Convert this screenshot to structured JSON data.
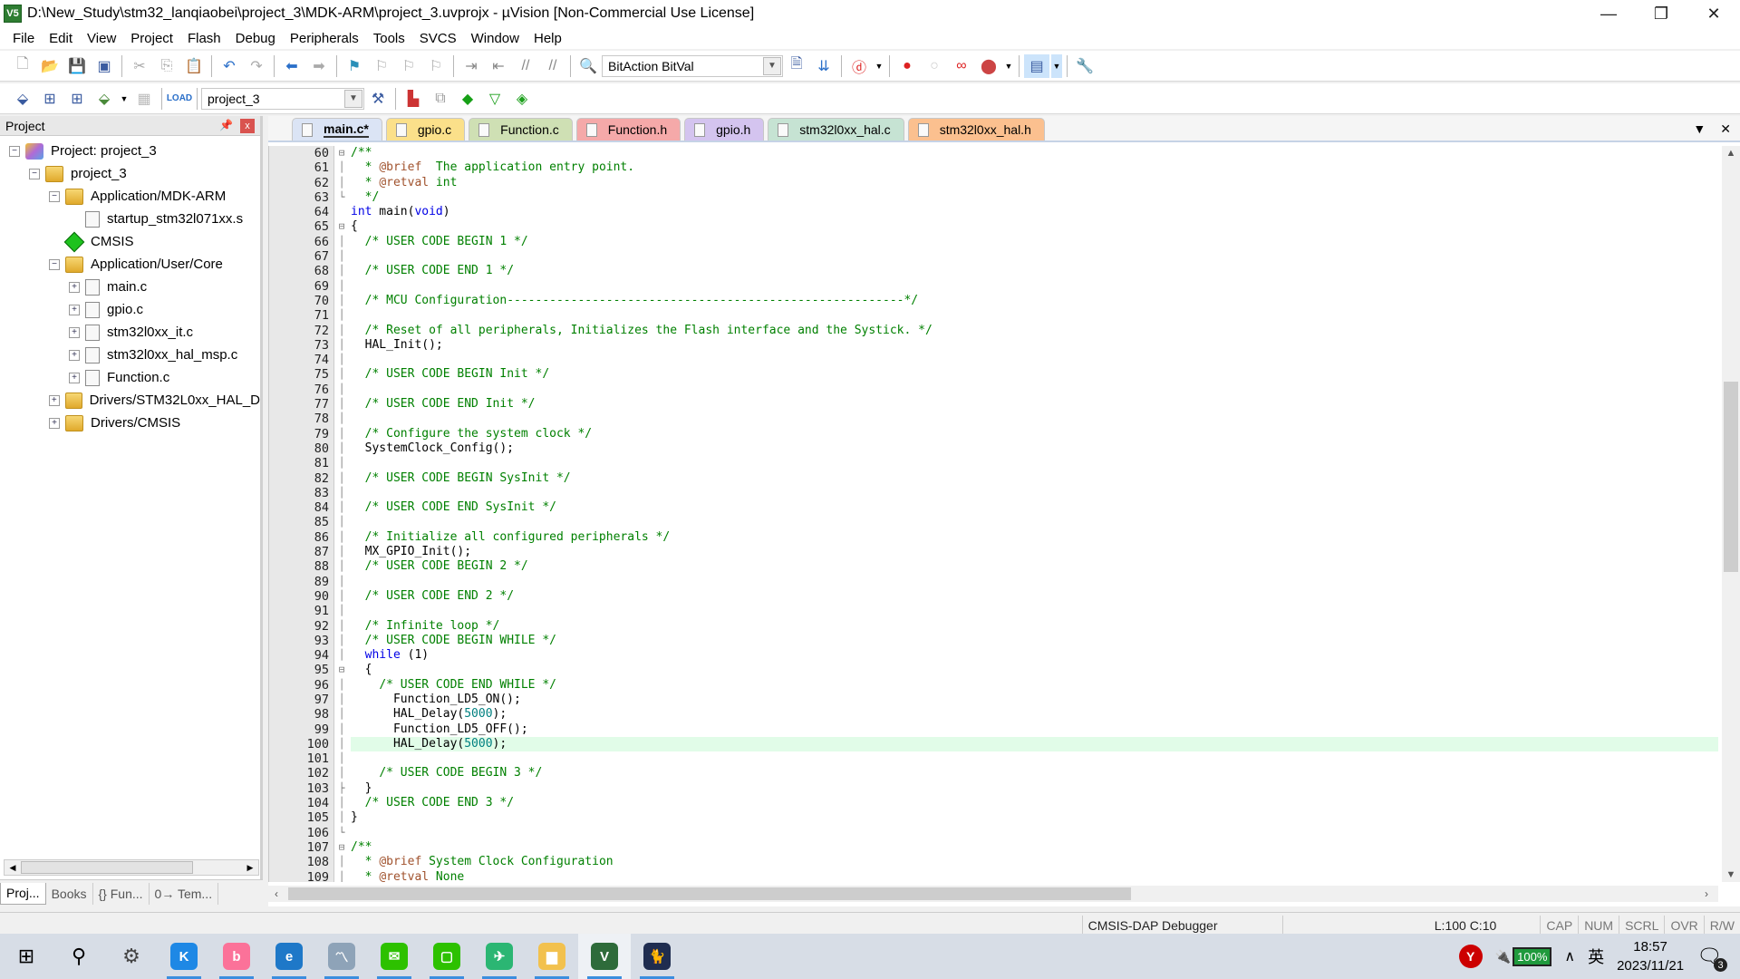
{
  "window": {
    "title": "D:\\New_Study\\stm32_lanqiaobei\\project_3\\MDK-ARM\\project_3.uvprojx - µVision  [Non-Commercial Use License]",
    "app_icon": "V5",
    "controls": {
      "minimize": "—",
      "restore": "❐",
      "close": "✕"
    }
  },
  "menu": [
    "File",
    "Edit",
    "View",
    "Project",
    "Flash",
    "Debug",
    "Peripherals",
    "Tools",
    "SVCS",
    "Window",
    "Help"
  ],
  "toolbar1": {
    "find_combo_value": "BitAction BitVal"
  },
  "toolbar2": {
    "target_combo_value": "project_3"
  },
  "project_panel": {
    "title": "Project",
    "tree": [
      {
        "level": 0,
        "type": "project",
        "label": "Project: project_3",
        "expander": "−"
      },
      {
        "level": 1,
        "type": "target",
        "label": "project_3",
        "expander": "−"
      },
      {
        "level": 2,
        "type": "folder",
        "label": "Application/MDK-ARM",
        "expander": "−"
      },
      {
        "level": 3,
        "type": "file",
        "label": "startup_stm32l071xx.s",
        "expander": ""
      },
      {
        "level": 2,
        "type": "cmsis",
        "label": "CMSIS",
        "expander": ""
      },
      {
        "level": 2,
        "type": "folder",
        "label": "Application/User/Core",
        "expander": "−"
      },
      {
        "level": 3,
        "type": "file",
        "label": "main.c",
        "expander": "+"
      },
      {
        "level": 3,
        "type": "file",
        "label": "gpio.c",
        "expander": "+"
      },
      {
        "level": 3,
        "type": "file",
        "label": "stm32l0xx_it.c",
        "expander": "+"
      },
      {
        "level": 3,
        "type": "file",
        "label": "stm32l0xx_hal_msp.c",
        "expander": "+"
      },
      {
        "level": 3,
        "type": "file",
        "label": "Function.c",
        "expander": "+"
      },
      {
        "level": 2,
        "type": "folder",
        "label": "Drivers/STM32L0xx_HAL_D",
        "expander": "+"
      },
      {
        "level": 2,
        "type": "folder",
        "label": "Drivers/CMSIS",
        "expander": "+"
      }
    ],
    "bottom_tabs": [
      "Proj...",
      "Books",
      "{} Fun...",
      "0→ Tem..."
    ]
  },
  "editor": {
    "tabs": [
      {
        "label": "main.c*",
        "color": "#dbe4f5",
        "active": true
      },
      {
        "label": "gpio.c",
        "color": "#fbe08a",
        "active": false
      },
      {
        "label": "Function.c",
        "color": "#cfe0b4",
        "active": false
      },
      {
        "label": "Function.h",
        "color": "#f5a9a9",
        "active": false
      },
      {
        "label": "gpio.h",
        "color": "#d4c4ef",
        "active": false
      },
      {
        "label": "stm32l0xx_hal.c",
        "color": "#c6e3d3",
        "active": false
      },
      {
        "label": "stm32l0xx_hal.h",
        "color": "#fbc08f",
        "active": false
      }
    ],
    "current_line": 100,
    "lines": [
      {
        "n": 60,
        "fold": "⊟",
        "html": "<span class='cm'>/**</span>"
      },
      {
        "n": 61,
        "fold": "│",
        "html": "<span class='cm'>  * <span class='tag'>@brief</span>  The application entry point.</span>"
      },
      {
        "n": 62,
        "fold": "│",
        "html": "<span class='cm'>  * <span class='tag'>@retval</span> int</span>"
      },
      {
        "n": 63,
        "fold": "└",
        "html": "<span class='cm'>  */</span>"
      },
      {
        "n": 64,
        "fold": "",
        "html": "<span class='kw'>int</span> main(<span class='kw'>void</span>)"
      },
      {
        "n": 65,
        "fold": "⊟",
        "html": "{"
      },
      {
        "n": 66,
        "fold": "│",
        "html": "  <span class='cm'>/* USER CODE BEGIN 1 */</span>"
      },
      {
        "n": 67,
        "fold": "│",
        "html": ""
      },
      {
        "n": 68,
        "fold": "│",
        "html": "  <span class='cm'>/* USER CODE END 1 */</span>"
      },
      {
        "n": 69,
        "fold": "│",
        "html": ""
      },
      {
        "n": 70,
        "fold": "│",
        "html": "  <span class='cm'>/* MCU Configuration--------------------------------------------------------*/</span>"
      },
      {
        "n": 71,
        "fold": "│",
        "html": ""
      },
      {
        "n": 72,
        "fold": "│",
        "html": "  <span class='cm'>/* Reset of all peripherals, Initializes the Flash interface and the Systick. */</span>"
      },
      {
        "n": 73,
        "fold": "│",
        "html": "  HAL_Init();"
      },
      {
        "n": 74,
        "fold": "│",
        "html": ""
      },
      {
        "n": 75,
        "fold": "│",
        "html": "  <span class='cm'>/* USER CODE BEGIN Init */</span>"
      },
      {
        "n": 76,
        "fold": "│",
        "html": ""
      },
      {
        "n": 77,
        "fold": "│",
        "html": "  <span class='cm'>/* USER CODE END Init */</span>"
      },
      {
        "n": 78,
        "fold": "│",
        "html": ""
      },
      {
        "n": 79,
        "fold": "│",
        "html": "  <span class='cm'>/* Configure the system clock */</span>"
      },
      {
        "n": 80,
        "fold": "│",
        "html": "  SystemClock_Config();"
      },
      {
        "n": 81,
        "fold": "│",
        "html": ""
      },
      {
        "n": 82,
        "fold": "│",
        "html": "  <span class='cm'>/* USER CODE BEGIN SysInit */</span>"
      },
      {
        "n": 83,
        "fold": "│",
        "html": ""
      },
      {
        "n": 84,
        "fold": "│",
        "html": "  <span class='cm'>/* USER CODE END SysInit */</span>"
      },
      {
        "n": 85,
        "fold": "│",
        "html": ""
      },
      {
        "n": 86,
        "fold": "│",
        "html": "  <span class='cm'>/* Initialize all configured peripherals */</span>"
      },
      {
        "n": 87,
        "fold": "│",
        "html": "  MX_GPIO_Init();"
      },
      {
        "n": 88,
        "fold": "│",
        "html": "  <span class='cm'>/* USER CODE BEGIN 2 */</span>"
      },
      {
        "n": 89,
        "fold": "│",
        "html": ""
      },
      {
        "n": 90,
        "fold": "│",
        "html": "  <span class='cm'>/* USER CODE END 2 */</span>"
      },
      {
        "n": 91,
        "fold": "│",
        "html": ""
      },
      {
        "n": 92,
        "fold": "│",
        "html": "  <span class='cm'>/* Infinite loop */</span>"
      },
      {
        "n": 93,
        "fold": "│",
        "html": "  <span class='cm'>/* USER CODE BEGIN WHILE */</span>"
      },
      {
        "n": 94,
        "fold": "│",
        "html": "  <span class='kw'>while</span> (1)"
      },
      {
        "n": 95,
        "fold": "⊟",
        "html": "  {"
      },
      {
        "n": 96,
        "fold": "│",
        "html": "    <span class='cm'>/* USER CODE END WHILE */</span>"
      },
      {
        "n": 97,
        "fold": "│",
        "html": "      Function_LD5_ON();"
      },
      {
        "n": 98,
        "fold": "│",
        "html": "      HAL_Delay(<span class='num'>5000</span>);"
      },
      {
        "n": 99,
        "fold": "│",
        "html": "      Function_LD5_OFF();"
      },
      {
        "n": 100,
        "fold": "│",
        "html": "      HAL_Delay(<span class='num'>5000</span>);"
      },
      {
        "n": 101,
        "fold": "│",
        "html": ""
      },
      {
        "n": 102,
        "fold": "│",
        "html": "    <span class='cm'>/* USER CODE BEGIN 3 */</span>"
      },
      {
        "n": 103,
        "fold": "├",
        "html": "  }"
      },
      {
        "n": 104,
        "fold": "│",
        "html": "  <span class='cm'>/* USER CODE END 3 */</span>"
      },
      {
        "n": 105,
        "fold": "│",
        "html": "}"
      },
      {
        "n": 106,
        "fold": "└",
        "html": ""
      },
      {
        "n": 107,
        "fold": "⊟",
        "html": "<span class='cm'>/**</span>"
      },
      {
        "n": 108,
        "fold": "│",
        "html": "<span class='cm'>  * <span class='tag'>@brief</span> System Clock Configuration</span>"
      },
      {
        "n": 109,
        "fold": "│",
        "html": "<span class='cm'>  * <span class='tag'>@retval</span> None</span>"
      }
    ]
  },
  "status": {
    "debugger": "CMSIS-DAP Debugger",
    "position": "L:100 C:10",
    "indicators": [
      "CAP",
      "NUM",
      "SCRL",
      "OVR",
      "R/W"
    ]
  },
  "taskbar": {
    "apps": [
      {
        "name": "start",
        "glyph": "⊞",
        "color": "#000000",
        "running": false
      },
      {
        "name": "search",
        "glyph": "⚲",
        "color": "#000000",
        "running": false
      },
      {
        "name": "settings",
        "glyph": "⚙",
        "color": "#444444",
        "running": false
      },
      {
        "name": "kugou",
        "glyph": "K",
        "color": "#1e88e5",
        "running": true
      },
      {
        "name": "bilibili",
        "glyph": "b",
        "color": "#fb7299",
        "running": true
      },
      {
        "name": "edge",
        "glyph": "e",
        "color": "#1e78c8",
        "running": true
      },
      {
        "name": "resource-monitor",
        "glyph": "〽",
        "color": "#8ea3b8",
        "running": true
      },
      {
        "name": "wechat",
        "glyph": "✉",
        "color": "#2dc100",
        "running": true
      },
      {
        "name": "wechat-window",
        "glyph": "▢",
        "color": "#2dc100",
        "running": true
      },
      {
        "name": "pdf-reader",
        "glyph": "✈",
        "color": "#2bb673",
        "running": true
      },
      {
        "name": "file-explorer",
        "glyph": "▆",
        "color": "#f2c14e",
        "running": true
      },
      {
        "name": "keil-uvision",
        "glyph": "V",
        "color": "#2e6b3a",
        "running": true
      },
      {
        "name": "cat-app",
        "glyph": "🐈",
        "color": "#1f2d50",
        "running": true
      }
    ],
    "tray": {
      "battery": "100%",
      "ime": "英",
      "time": "18:57",
      "date": "2023/11/21",
      "notifications": "3"
    }
  }
}
